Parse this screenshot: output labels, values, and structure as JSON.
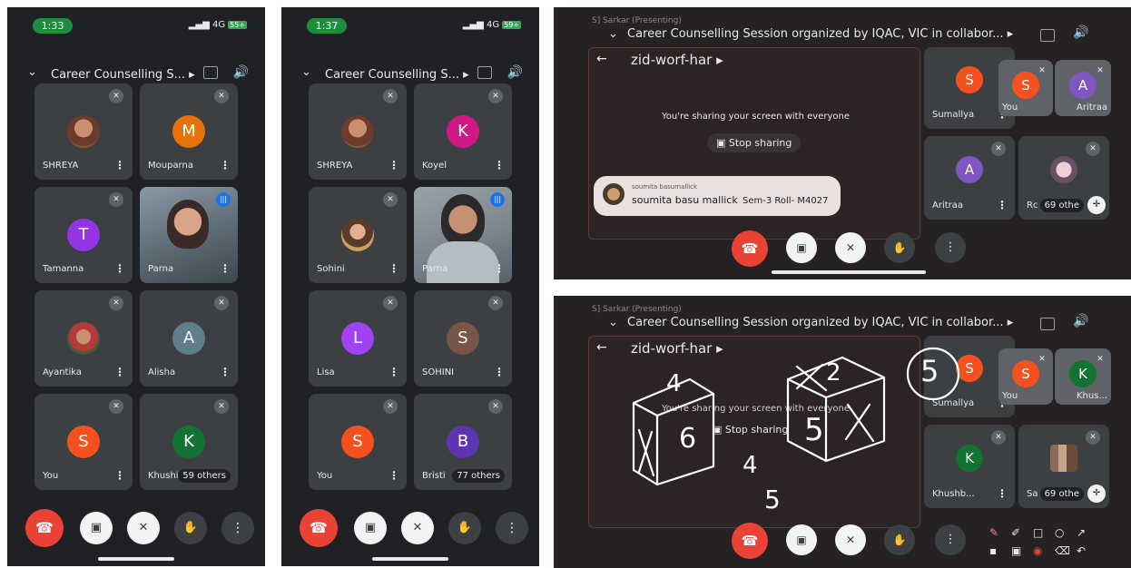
{
  "phone1": {
    "time": "1:33",
    "signal": "4G",
    "battery": "55+",
    "meeting_title": "Career Counselling S...",
    "tiles": [
      {
        "name": "SHREYA",
        "initial": "",
        "color": "",
        "photo": true
      },
      {
        "name": "Mouparna",
        "initial": "M",
        "color": "#e8710a"
      },
      {
        "name": "Tamanna",
        "initial": "T",
        "color": "#9334e6"
      },
      {
        "name": "Parna",
        "initial": "",
        "color": "",
        "video": true,
        "speaking": true
      },
      {
        "name": "Ayantika",
        "initial": "",
        "color": "",
        "photo": true
      },
      {
        "name": "Alisha",
        "initial": "A",
        "color": "#607d8b"
      },
      {
        "name": "You",
        "initial": "S",
        "color": "#f4511e"
      },
      {
        "name": "Khushi",
        "initial": "K",
        "color": "#137333",
        "others": "59 others"
      }
    ]
  },
  "phone2": {
    "time": "1:37",
    "signal": "4G",
    "battery": "59+",
    "meeting_title": "Career Counselling S...",
    "tiles": [
      {
        "name": "SHREYA",
        "initial": "",
        "color": "",
        "photo": true
      },
      {
        "name": "Koyel",
        "initial": "K",
        "color": "#d01884"
      },
      {
        "name": "Sohini",
        "initial": "",
        "color": "",
        "photo": true
      },
      {
        "name": "Parna",
        "initial": "",
        "color": "",
        "video": true,
        "speaking": true
      },
      {
        "name": "Lisa",
        "initial": "L",
        "color": "#a142f4"
      },
      {
        "name": "SOHINI",
        "initial": "S",
        "color": "#795548"
      },
      {
        "name": "You",
        "initial": "S",
        "color": "#f4511e"
      },
      {
        "name": "Bristi",
        "initial": "B",
        "color": "#5e35b1",
        "others": "77 others"
      }
    ]
  },
  "land1": {
    "presenter": "S] Sarkar (Presenting)",
    "title": "Career Counselling Session organized by IQAC, VIC in collabor...",
    "code": "zid-worf-har",
    "share_msg": "You're sharing your screen with everyone",
    "stop_label": "Stop sharing",
    "chat_sender": "soumita basumallick",
    "chat_text": "soumita basu mallick",
    "chat_extra": "Sem-3 Roll- M4027",
    "tiles": [
      {
        "name": "Sumallya",
        "initial": "S",
        "color": "#f4511e"
      },
      {
        "name": "You",
        "initial": "S",
        "color": "#f4511e"
      },
      {
        "name": "Aritraa",
        "initial": "A",
        "color": "#7e57c2"
      },
      {
        "name": "Aritraa",
        "initial": "A",
        "color": "#7e57c2"
      },
      {
        "name": "Rc",
        "initial": "",
        "color": "",
        "photo": true,
        "others": "69 othe"
      }
    ]
  },
  "land2": {
    "presenter": "S] Sarkar (Presenting)",
    "title": "Career Counselling Session organized by IQAC, VIC in collabor...",
    "code": "zid-worf-har",
    "share_msg": "You're sharing your screen with everyone",
    "stop_label": "Stop sharing",
    "tiles": [
      {
        "name": "Sumallya",
        "initial": "S",
        "color": "#f4511e"
      },
      {
        "name": "You",
        "initial": "S",
        "color": "#f4511e"
      },
      {
        "name": "Khus...",
        "initial": "K",
        "color": "#137333"
      },
      {
        "name": "Khushb...",
        "initial": "K",
        "color": "#137333"
      },
      {
        "name": "Sa",
        "initial": "",
        "color": "",
        "photo": true,
        "others": "69 othe"
      }
    ],
    "drawn_digits": [
      "4",
      "2",
      "5",
      "6",
      "5",
      "4",
      "5"
    ]
  }
}
